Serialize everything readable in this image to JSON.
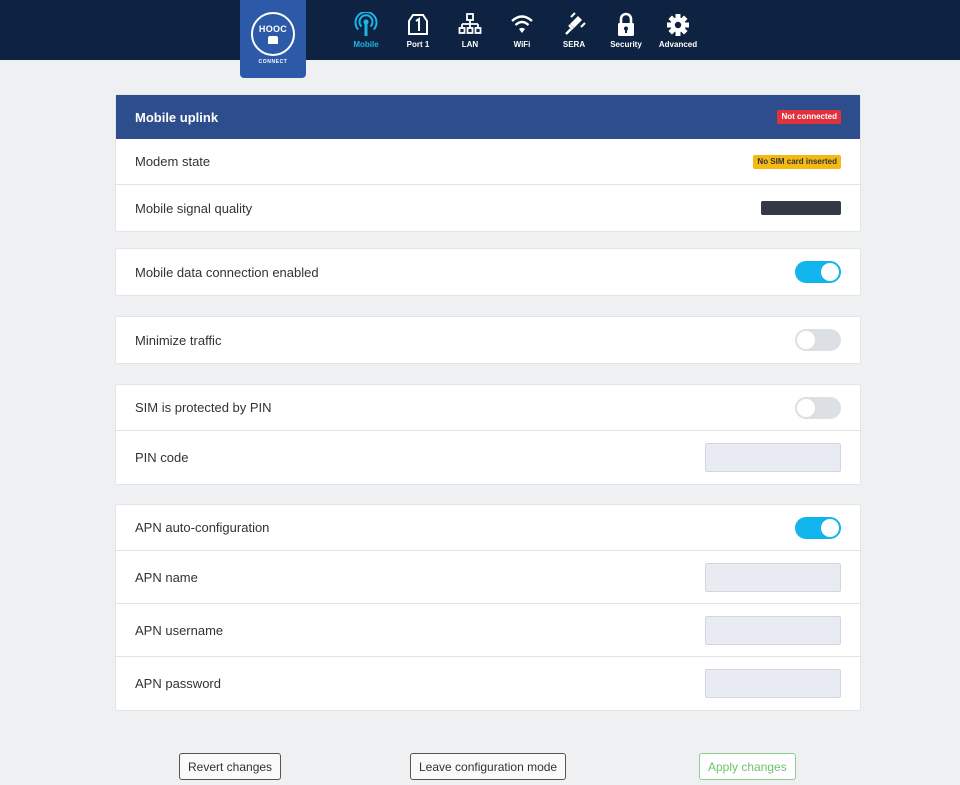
{
  "brand": {
    "logo_text": "HOOC",
    "logo_sub": "CONNECT"
  },
  "nav": [
    {
      "label": "Mobile",
      "icon": "mobile-antenna-icon",
      "active": true
    },
    {
      "label": "Port 1",
      "icon": "port-icon",
      "active": false
    },
    {
      "label": "LAN",
      "icon": "lan-icon",
      "active": false
    },
    {
      "label": "WiFi",
      "icon": "wifi-icon",
      "active": false
    },
    {
      "label": "SERA",
      "icon": "plug-icon",
      "active": false
    },
    {
      "label": "Security",
      "icon": "lock-icon",
      "active": false
    },
    {
      "label": "Advanced",
      "icon": "gear-icon",
      "active": false
    }
  ],
  "mobile_uplink": {
    "title": "Mobile uplink",
    "status": "Not connected",
    "modem_state_label": "Modem state",
    "modem_state_value": "No SIM card inserted",
    "signal_quality_label": "Mobile signal quality"
  },
  "mobile_data": {
    "label": "Mobile data connection enabled",
    "enabled": true
  },
  "minimize_traffic": {
    "label": "Minimize traffic",
    "enabled": false
  },
  "sim": {
    "pin_protected_label": "SIM is protected by PIN",
    "pin_protected": false,
    "pin_code_label": "PIN code",
    "pin_code_value": ""
  },
  "apn": {
    "auto_config_label": "APN auto-configuration",
    "auto_config": true,
    "name_label": "APN name",
    "name_value": "",
    "username_label": "APN username",
    "username_value": "",
    "password_label": "APN password",
    "password_value": ""
  },
  "actions": {
    "revert": "Revert changes",
    "leave": "Leave configuration mode",
    "apply": "Apply changes"
  },
  "colors": {
    "nav_bg": "#0e2341",
    "header_bg": "#2d4d8c",
    "accent": "#12b4ec",
    "danger": "#e0313d",
    "warning": "#f5b914",
    "apply_green": "#6cc36c"
  }
}
